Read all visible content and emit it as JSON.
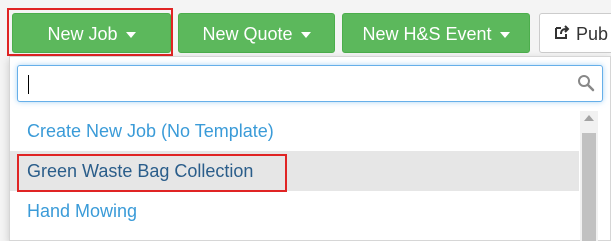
{
  "toolbar": {
    "new_job_label": "New Job",
    "new_quote_label": "New Quote",
    "new_hs_event_label": "New H&S Event",
    "pub_label": "Pub",
    "accent_color": "#5cb85c"
  },
  "dropdown": {
    "search_value": "",
    "search_icon": "search-icon",
    "options": [
      {
        "label": "Create New Job (No Template)",
        "selected": false
      },
      {
        "label": "Green Waste Bag Collection",
        "selected": true
      },
      {
        "label": "Hand Mowing",
        "selected": false
      }
    ],
    "link_color": "#3a9bd8",
    "highlight_color": "#e02424"
  }
}
